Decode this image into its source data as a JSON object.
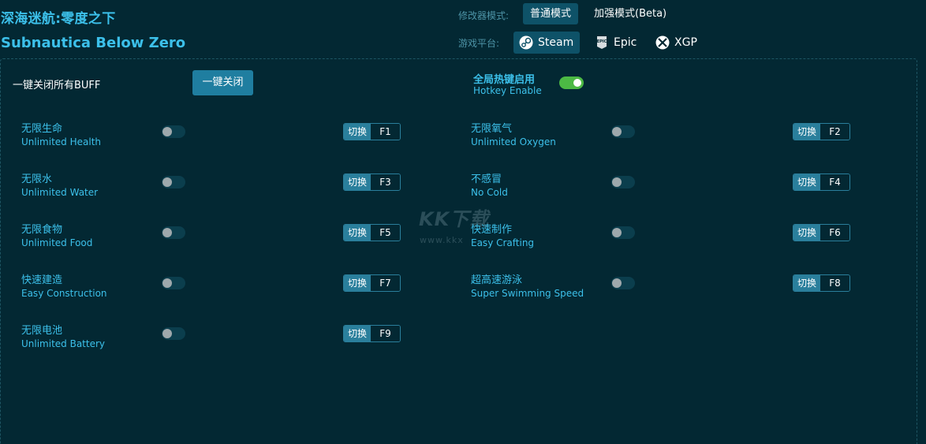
{
  "header": {
    "title_cn": "深海迷航:零度之下",
    "title_en": "Subnautica Below Zero",
    "mode_label": "修改器模式:",
    "modes": [
      {
        "label": "普通模式",
        "active": true
      },
      {
        "label": "加强模式(Beta)",
        "active": false
      }
    ],
    "platform_label": "游戏平台:",
    "platforms": [
      {
        "label": "Steam",
        "icon": "steam-icon",
        "active": true
      },
      {
        "label": "Epic",
        "icon": "epic-icon",
        "active": false
      },
      {
        "label": "XGP",
        "icon": "xbox-icon",
        "active": false
      }
    ]
  },
  "controls": {
    "kill_all_label": "一键关闭所有BUFF",
    "kill_all_button": "一键关闭",
    "hotkey_enable_cn": "全局热键启用",
    "hotkey_enable_en": "Hotkey Enable",
    "hotkey_enabled": true
  },
  "switch_label": "切换",
  "features": [
    {
      "cn": "无限生命",
      "en": "Unlimited Health",
      "key": "F1",
      "enabled": false
    },
    {
      "cn": "无限氧气",
      "en": "Unlimited Oxygen",
      "key": "F2",
      "enabled": false
    },
    {
      "cn": "无限水",
      "en": "Unlimited Water",
      "key": "F3",
      "enabled": false
    },
    {
      "cn": "不感冒",
      "en": "No Cold",
      "key": "F4",
      "enabled": false
    },
    {
      "cn": "无限食物",
      "en": "Unlimited Food",
      "key": "F5",
      "enabled": false
    },
    {
      "cn": "快速制作",
      "en": "Easy Crafting",
      "key": "F6",
      "enabled": false
    },
    {
      "cn": "快速建造",
      "en": "Easy Construction",
      "key": "F7",
      "enabled": false
    },
    {
      "cn": "超高速游泳",
      "en": "Super Swimming Speed",
      "key": "F8",
      "enabled": false
    },
    {
      "cn": "无限电池",
      "en": "Unlimited Battery",
      "key": "F9",
      "enabled": false
    }
  ],
  "watermark": {
    "logo": "KK下载",
    "url": "www.kkx"
  },
  "colors": {
    "background": "#032833",
    "accent": "#3cc0ea",
    "button": "#1f7ea0",
    "toggle_on": "#4cb944"
  }
}
